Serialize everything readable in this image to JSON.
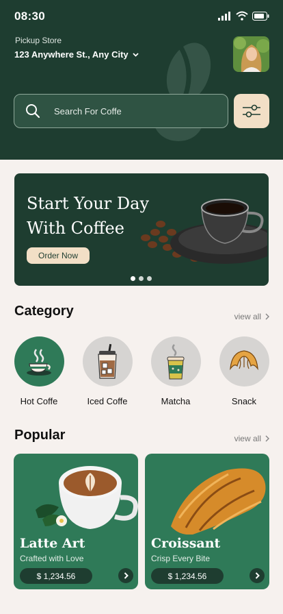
{
  "status": {
    "time": "08:30"
  },
  "header": {
    "pickup_label": "Pickup Store",
    "address": "123 Anywhere St., Any City"
  },
  "search": {
    "placeholder": "Search For Coffe"
  },
  "banner": {
    "title_line1": "Start Your Day",
    "title_line2": "With Coffee",
    "cta": "Order Now",
    "slide_count": 3,
    "active_slide": 1
  },
  "category": {
    "title": "Category",
    "view_all": "view all",
    "items": [
      {
        "label": "Hot Coffe",
        "icon": "hot-coffee-icon",
        "active": true
      },
      {
        "label": "Iced Coffe",
        "icon": "iced-coffee-icon",
        "active": false
      },
      {
        "label": "Matcha",
        "icon": "matcha-icon",
        "active": false
      },
      {
        "label": "Snack",
        "icon": "croissant-icon",
        "active": false
      }
    ]
  },
  "popular": {
    "title": "Popular",
    "view_all": "view all",
    "items": [
      {
        "name": "Latte Art",
        "subtitle": "Crafted with Love",
        "price": "$ 1,234.56"
      },
      {
        "name": "Croissant",
        "subtitle": "Crisp Every Bite",
        "price": "$ 1,234.56"
      }
    ]
  },
  "colors": {
    "primary_dark": "#1e3d30",
    "primary": "#2f7a58",
    "accent_cream": "#f2dfc6",
    "background": "#f6f1ee"
  }
}
